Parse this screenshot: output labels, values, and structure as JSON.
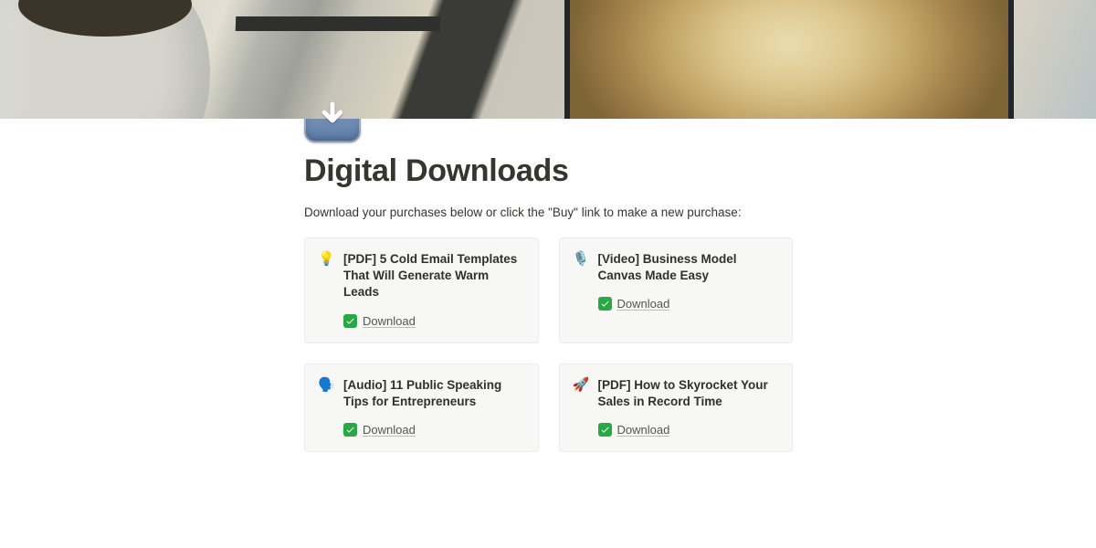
{
  "page": {
    "icon": "arrow-down-badge",
    "title": "Digital Downloads",
    "intro": "Download your purchases below or click the \"Buy\" link to make a new purchase:"
  },
  "downloads": {
    "action_label": "Download",
    "items": [
      {
        "emoji": "💡",
        "title": "[PDF] 5 Cold Email Templates That Will Generate Warm Leads"
      },
      {
        "emoji": "🎙️",
        "title": "[Video] Business Model Canvas Made Easy"
      },
      {
        "emoji": "🗣️",
        "title": "[Audio] 11 Public Speaking Tips for Entrepreneurs"
      },
      {
        "emoji": "🚀",
        "title": "[PDF] How to Skyrocket Your Sales in Record Time"
      }
    ]
  }
}
